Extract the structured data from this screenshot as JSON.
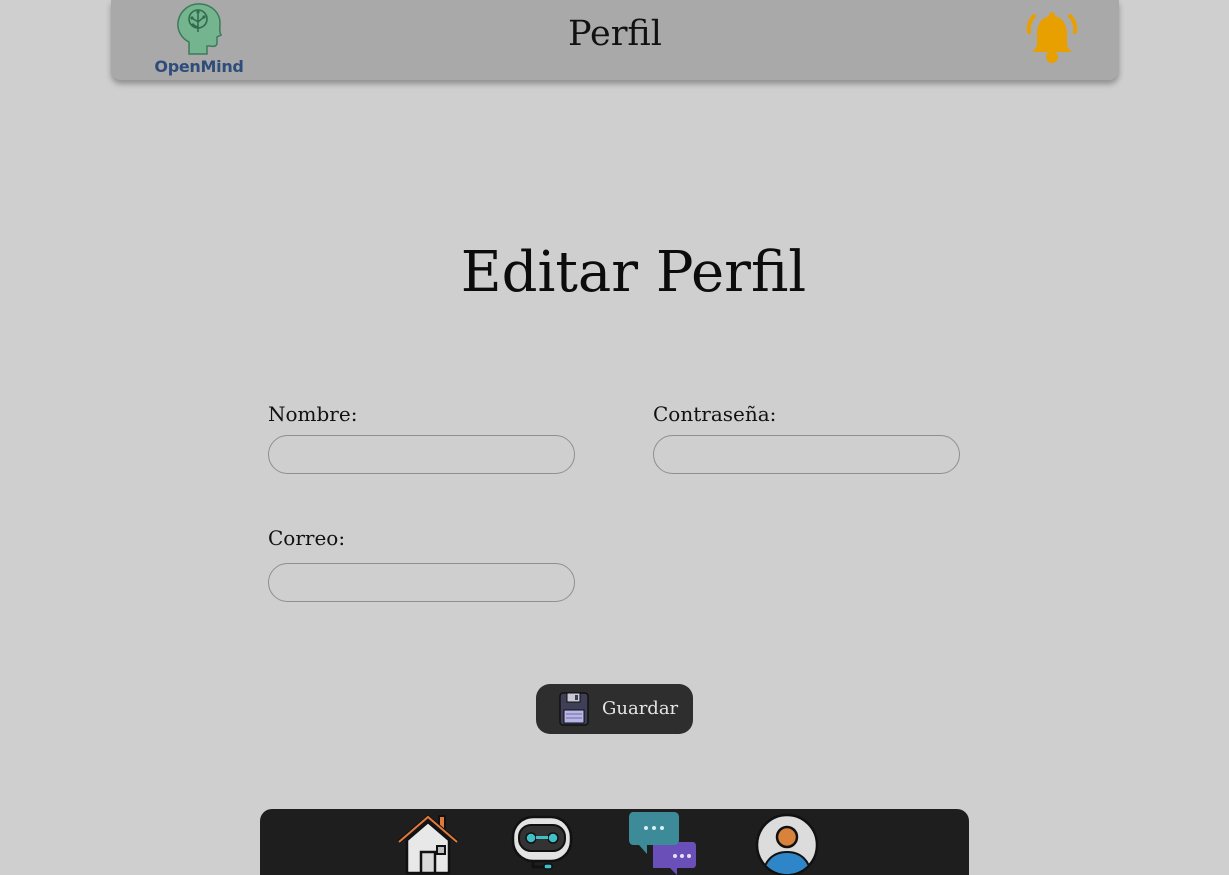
{
  "header": {
    "logo_text": "OpenMind",
    "title": "Perfil"
  },
  "main": {
    "heading": "Editar Perfil",
    "fields": {
      "nombre": {
        "label": "Nombre:",
        "value": "",
        "placeholder": ""
      },
      "contrasena": {
        "label": "Contraseña:",
        "value": "",
        "placeholder": ""
      },
      "correo": {
        "label": "Correo:",
        "value": "",
        "placeholder": ""
      }
    },
    "save_button": {
      "label": "Guardar",
      "icon": "floppy-disk-icon"
    }
  },
  "bottom_nav": {
    "items": [
      {
        "id": "home",
        "icon": "house-icon"
      },
      {
        "id": "bot",
        "icon": "robot-icon"
      },
      {
        "id": "chat",
        "icon": "chat-bubbles-icon"
      },
      {
        "id": "profile",
        "icon": "user-avatar-icon"
      }
    ]
  },
  "colors": {
    "background": "#cfcfcf",
    "header": "#a9a9a9",
    "bell": "#e8a000",
    "nav": "#1e1e1e",
    "button": "#2e2e2e"
  }
}
